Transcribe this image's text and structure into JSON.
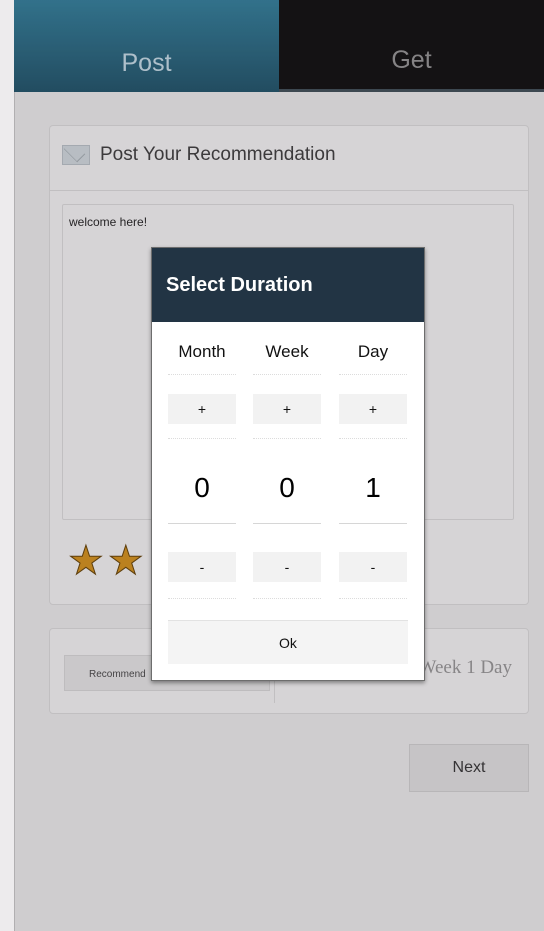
{
  "tabs": [
    {
      "label": "Post",
      "active": true
    },
    {
      "label": "Get",
      "active": false
    }
  ],
  "post_card": {
    "title": "Post Your Recommendation",
    "title_icon": "envelope-icon",
    "message": "welcome here!",
    "rating_stars_visible": 2
  },
  "options": {
    "recommend_label": "Recommend",
    "duration_value": "Post For: 1 Week 1 Day"
  },
  "next_button": "Next",
  "dialog": {
    "title": "Select Duration",
    "columns": [
      {
        "label": "Month",
        "value": "0",
        "plus": "+",
        "minus": "-"
      },
      {
        "label": "Week",
        "value": "0",
        "plus": "+",
        "minus": "-"
      },
      {
        "label": "Day",
        "value": "1",
        "plus": "+",
        "minus": "-"
      }
    ],
    "ok_label": "Ok"
  },
  "colors": {
    "header_dark": "#223444",
    "tab_active": "#2f7892",
    "star": "#c88a1a"
  }
}
